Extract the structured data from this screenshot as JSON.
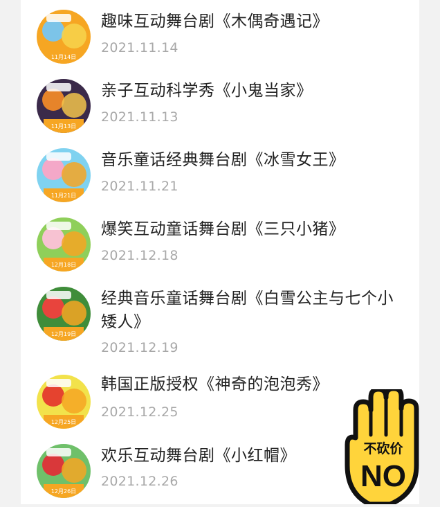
{
  "events": [
    {
      "title": "趣味互动舞台剧《木偶奇遇记》",
      "date": "2021.11.14",
      "thumb_label": "11月14日",
      "thumb_icon": "puppet-poster-icon",
      "colors": [
        "#f6a623",
        "#7cc4e8",
        "#f7d44c"
      ]
    },
    {
      "title": "亲子互动科学秀《小鬼当家》",
      "date": "2021.11.13",
      "thumb_label": "11月13日",
      "thumb_icon": "ghost-poster-icon",
      "colors": [
        "#3b2a4a",
        "#e6842a",
        "#f2c34b"
      ]
    },
    {
      "title": "音乐童话经典舞台剧《冰雪女王》",
      "date": "2021.11.21",
      "thumb_label": "11月21日",
      "thumb_icon": "snow-queen-poster-icon",
      "colors": [
        "#7fd2f0",
        "#f4a8c8",
        "#f6a623"
      ]
    },
    {
      "title": "爆笑互动童话舞台剧《三只小猪》",
      "date": "2021.12.18",
      "thumb_label": "12月18日",
      "thumb_icon": "three-pigs-poster-icon",
      "colors": [
        "#8fcf5a",
        "#f7c2d2",
        "#f6a623"
      ]
    },
    {
      "title": "经典音乐童话舞台剧《白雪公主与七个小矮人》",
      "date": "2021.12.19",
      "thumb_label": "12月19日",
      "thumb_icon": "snow-white-poster-icon",
      "colors": [
        "#3f8d3a",
        "#e8443d",
        "#f6a623"
      ]
    },
    {
      "title": "韩国正版授权《神奇的泡泡秀》",
      "date": "2021.12.25",
      "thumb_label": "12月25日",
      "thumb_icon": "bubble-show-poster-icon",
      "colors": [
        "#f2e24b",
        "#e5432f",
        "#f6a623"
      ]
    },
    {
      "title": "欢乐互动舞台剧《小红帽》",
      "date": "2021.12.26",
      "thumb_label": "12月26日",
      "thumb_icon": "red-hood-poster-icon",
      "colors": [
        "#6fc06a",
        "#d9383a",
        "#f6a623"
      ]
    }
  ],
  "badge": {
    "line1": "不砍价",
    "line2": "NO",
    "icon": "stop-hand-icon",
    "fill": "#ffd43b",
    "stroke": "#111111"
  }
}
